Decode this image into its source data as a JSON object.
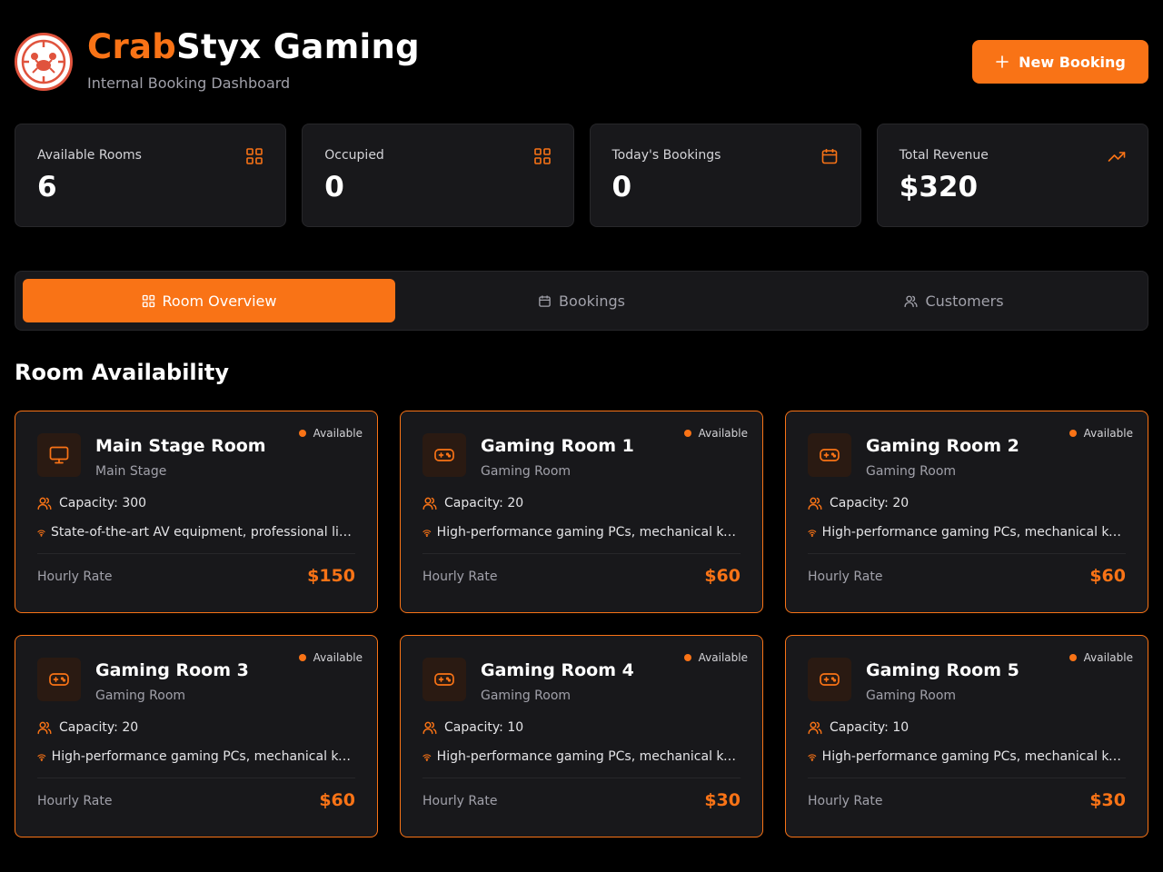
{
  "header": {
    "brand_accent": "Crab",
    "brand_rest": "Styx Gaming",
    "subtitle": "Internal Booking Dashboard",
    "new_booking_label": "New Booking"
  },
  "stats": [
    {
      "label": "Available Rooms",
      "value": "6",
      "icon": "grid-icon"
    },
    {
      "label": "Occupied",
      "value": "0",
      "icon": "grid-icon"
    },
    {
      "label": "Today's Bookings",
      "value": "0",
      "icon": "calendar-icon"
    },
    {
      "label": "Total Revenue",
      "value": "$320",
      "icon": "trending-up-icon"
    }
  ],
  "tabs": [
    {
      "label": "Room Overview",
      "icon": "grid-icon",
      "active": true
    },
    {
      "label": "Bookings",
      "icon": "calendar-icon",
      "active": false
    },
    {
      "label": "Customers",
      "icon": "users-icon",
      "active": false
    }
  ],
  "section_title": "Room Availability",
  "rooms": [
    {
      "name": "Main Stage Room",
      "type": "Main Stage",
      "status": "Available",
      "capacity": "Capacity: 300",
      "features": "State-of-the-art AV equipment, professional lighting, stage",
      "rate_label": "Hourly Rate",
      "rate": "$150",
      "icon": "monitor-icon"
    },
    {
      "name": "Gaming Room 1",
      "type": "Gaming Room",
      "status": "Available",
      "capacity": "Capacity: 20",
      "features": "High-performance gaming PCs, mechanical keyboards",
      "rate_label": "Hourly Rate",
      "rate": "$60",
      "icon": "gamepad-icon"
    },
    {
      "name": "Gaming Room 2",
      "type": "Gaming Room",
      "status": "Available",
      "capacity": "Capacity: 20",
      "features": "High-performance gaming PCs, mechanical keyboards",
      "rate_label": "Hourly Rate",
      "rate": "$60",
      "icon": "gamepad-icon"
    },
    {
      "name": "Gaming Room 3",
      "type": "Gaming Room",
      "status": "Available",
      "capacity": "Capacity: 20",
      "features": "High-performance gaming PCs, mechanical keyboards",
      "rate_label": "Hourly Rate",
      "rate": "$60",
      "icon": "gamepad-icon"
    },
    {
      "name": "Gaming Room 4",
      "type": "Gaming Room",
      "status": "Available",
      "capacity": "Capacity: 10",
      "features": "High-performance gaming PCs, mechanical keyboards",
      "rate_label": "Hourly Rate",
      "rate": "$30",
      "icon": "gamepad-icon"
    },
    {
      "name": "Gaming Room 5",
      "type": "Gaming Room",
      "status": "Available",
      "capacity": "Capacity: 10",
      "features": "High-performance gaming PCs, mechanical keyboards",
      "rate_label": "Hourly Rate",
      "rate": "$30",
      "icon": "gamepad-icon"
    }
  ],
  "colors": {
    "accent": "#f97316",
    "background": "#000000",
    "card": "#18181b",
    "border": "#27272a"
  }
}
